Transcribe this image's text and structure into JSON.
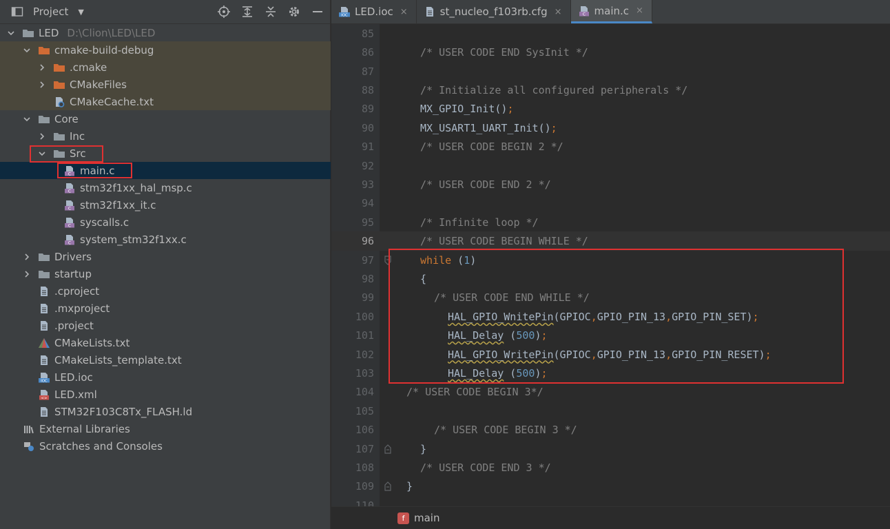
{
  "project_panel": {
    "title": "Project",
    "tools": [
      "locate-icon",
      "expand-all-icon",
      "collapse-all-icon",
      "settings-icon",
      "hide-icon"
    ],
    "tree": [
      {
        "label": "LED",
        "path": "D:\\Clion\\LED\\LED",
        "depth": 0,
        "arrow": "down",
        "icon": "folder"
      },
      {
        "label": "cmake-build-debug",
        "depth": 1,
        "arrow": "down",
        "icon": "folder-orange",
        "style": "build"
      },
      {
        "label": ".cmake",
        "depth": 2,
        "arrow": "right",
        "icon": "folder-orange",
        "style": "build"
      },
      {
        "label": "CMakeFiles",
        "depth": 2,
        "arrow": "right",
        "icon": "folder-orange",
        "style": "build"
      },
      {
        "label": "CMakeCache.txt",
        "depth": 2,
        "arrow": "none",
        "icon": "cmake-cache",
        "style": "build"
      },
      {
        "label": "Core",
        "depth": 1,
        "arrow": "down",
        "icon": "folder"
      },
      {
        "label": "Inc",
        "depth": 2,
        "arrow": "right",
        "icon": "folder"
      },
      {
        "label": "Src",
        "depth": 2,
        "arrow": "down",
        "icon": "folder"
      },
      {
        "label": "main.c",
        "depth": 3,
        "arrow": "none",
        "icon": "c-file",
        "style": "selected"
      },
      {
        "label": "stm32f1xx_hal_msp.c",
        "depth": 3,
        "arrow": "none",
        "icon": "c-file"
      },
      {
        "label": "stm32f1xx_it.c",
        "depth": 3,
        "arrow": "none",
        "icon": "c-file"
      },
      {
        "label": "syscalls.c",
        "depth": 3,
        "arrow": "none",
        "icon": "c-file"
      },
      {
        "label": "system_stm32f1xx.c",
        "depth": 3,
        "arrow": "none",
        "icon": "c-file"
      },
      {
        "label": "Drivers",
        "depth": 1,
        "arrow": "right",
        "icon": "folder"
      },
      {
        "label": "startup",
        "depth": 1,
        "arrow": "right",
        "icon": "folder"
      },
      {
        "label": ".cproject",
        "depth": 1,
        "arrow": "none",
        "icon": "text-file"
      },
      {
        "label": ".mxproject",
        "depth": 1,
        "arrow": "none",
        "icon": "text-file"
      },
      {
        "label": ".project",
        "depth": 1,
        "arrow": "none",
        "icon": "text-file"
      },
      {
        "label": "CMakeLists.txt",
        "depth": 1,
        "arrow": "none",
        "icon": "cmake-file"
      },
      {
        "label": "CMakeLists_template.txt",
        "depth": 1,
        "arrow": "none",
        "icon": "text-file"
      },
      {
        "label": "LED.ioc",
        "depth": 1,
        "arrow": "none",
        "icon": "ioc-file"
      },
      {
        "label": "LED.xml",
        "depth": 1,
        "arrow": "none",
        "icon": "xml-file"
      },
      {
        "label": "STM32F103C8Tx_FLASH.ld",
        "depth": 1,
        "arrow": "none",
        "icon": "text-file"
      },
      {
        "label": "External Libraries",
        "depth": 0,
        "arrow": "gap",
        "icon": "libraries"
      },
      {
        "label": "Scratches and Consoles",
        "depth": 0,
        "arrow": "gap",
        "icon": "scratches"
      }
    ]
  },
  "editor": {
    "tabs": [
      {
        "label": "LED.ioc",
        "icon": "ioc-file",
        "active": false
      },
      {
        "label": "st_nucleo_f103rb.cfg",
        "icon": "text-file",
        "active": false
      },
      {
        "label": "main.c",
        "icon": "c-file",
        "active": true
      }
    ],
    "tab_close": "×",
    "current_line": 96,
    "lines": [
      {
        "n": "85",
        "indent": 0,
        "parts": []
      },
      {
        "n": "86",
        "indent": 4,
        "parts": [
          {
            "t": "/* USER CODE END SysInit */",
            "c": "cmt"
          }
        ]
      },
      {
        "n": "87",
        "indent": 0,
        "parts": []
      },
      {
        "n": "88",
        "indent": 4,
        "parts": [
          {
            "t": "/* Initialize all configured peripherals */",
            "c": "cmt"
          }
        ]
      },
      {
        "n": "89",
        "indent": 4,
        "parts": [
          {
            "t": "MX_GPIO_Init()",
            "c": ""
          },
          {
            "t": ";",
            "c": "punct"
          }
        ]
      },
      {
        "n": "90",
        "indent": 4,
        "parts": [
          {
            "t": "MX_USART1_UART_Init()",
            "c": ""
          },
          {
            "t": ";",
            "c": "punct"
          }
        ]
      },
      {
        "n": "91",
        "indent": 4,
        "parts": [
          {
            "t": "/* USER CODE BEGIN 2 */",
            "c": "cmt"
          }
        ]
      },
      {
        "n": "92",
        "indent": 0,
        "parts": []
      },
      {
        "n": "93",
        "indent": 4,
        "parts": [
          {
            "t": "/* USER CODE END 2 */",
            "c": "cmt"
          }
        ]
      },
      {
        "n": "94",
        "indent": 0,
        "parts": []
      },
      {
        "n": "95",
        "indent": 4,
        "parts": [
          {
            "t": "/* Infinite loop */",
            "c": "cmt"
          }
        ]
      },
      {
        "n": "96",
        "indent": 4,
        "parts": [
          {
            "t": "/* USER CODE BEGIN WHILE */",
            "c": "cmt"
          }
        ]
      },
      {
        "n": "97",
        "indent": 4,
        "fold": "open",
        "parts": [
          {
            "t": "while",
            "c": "kw"
          },
          {
            "t": " (",
            "c": ""
          },
          {
            "t": "1",
            "c": "num"
          },
          {
            "t": ")",
            "c": ""
          }
        ]
      },
      {
        "n": "98",
        "indent": 4,
        "parts": [
          {
            "t": "{",
            "c": ""
          }
        ]
      },
      {
        "n": "99",
        "indent": 6,
        "parts": [
          {
            "t": "/* USER CODE END WHILE */",
            "c": "cmt"
          }
        ]
      },
      {
        "n": "100",
        "indent": 8,
        "parts": [
          {
            "t": "HAL_GPIO_WnitePin",
            "c": "warn"
          },
          {
            "t": "(GPIOC",
            "c": ""
          },
          {
            "t": ",",
            "c": "punct"
          },
          {
            "t": "GPIO_PIN_13",
            "c": ""
          },
          {
            "t": ",",
            "c": "punct"
          },
          {
            "t": "GPIO_PIN_SET)",
            "c": ""
          },
          {
            "t": ";",
            "c": "punct"
          }
        ]
      },
      {
        "n": "101",
        "indent": 8,
        "parts": [
          {
            "t": "HAL_Delay",
            "c": "warn"
          },
          {
            "t": " (",
            "c": ""
          },
          {
            "t": "500",
            "c": "num"
          },
          {
            "t": ")",
            "c": ""
          },
          {
            "t": ";",
            "c": "punct"
          }
        ]
      },
      {
        "n": "102",
        "indent": 8,
        "parts": [
          {
            "t": "HAL_GPIO_WritePin",
            "c": "warn"
          },
          {
            "t": "(GPIOC",
            "c": ""
          },
          {
            "t": ",",
            "c": "punct"
          },
          {
            "t": "GPIO_PIN_13",
            "c": ""
          },
          {
            "t": ",",
            "c": "punct"
          },
          {
            "t": "GPIO_PIN_RESET)",
            "c": ""
          },
          {
            "t": ";",
            "c": "punct"
          }
        ]
      },
      {
        "n": "103",
        "indent": 8,
        "parts": [
          {
            "t": "HAL_Delay",
            "c": "warn"
          },
          {
            "t": " (",
            "c": ""
          },
          {
            "t": "500",
            "c": "num"
          },
          {
            "t": ")",
            "c": ""
          },
          {
            "t": ";",
            "c": "punct"
          }
        ]
      },
      {
        "n": "104",
        "indent": 2,
        "parts": [
          {
            "t": "/* USER CODE BEGIN 3*/",
            "c": "cmt"
          }
        ]
      },
      {
        "n": "105",
        "indent": 0,
        "parts": []
      },
      {
        "n": "106",
        "indent": 6,
        "parts": [
          {
            "t": "/* USER CODE BEGIN 3 */",
            "c": "cmt"
          }
        ]
      },
      {
        "n": "107",
        "indent": 4,
        "fold": "close",
        "parts": [
          {
            "t": "}",
            "c": ""
          }
        ]
      },
      {
        "n": "108",
        "indent": 4,
        "parts": [
          {
            "t": "/* USER CODE END 3 */",
            "c": "cmt"
          }
        ]
      },
      {
        "n": "109",
        "indent": 2,
        "fold": "close",
        "parts": [
          {
            "t": "}",
            "c": ""
          }
        ]
      },
      {
        "n": "110",
        "indent": 0,
        "parts": []
      }
    ],
    "breadcrumb": {
      "badge": "f",
      "label": "main"
    }
  },
  "colors": {
    "highlight_box": "#e03131",
    "folder": "#90999f",
    "folder_orange": "#d06b35",
    "c_file": "#9876aa",
    "ioc_file": "#4a88c7"
  }
}
